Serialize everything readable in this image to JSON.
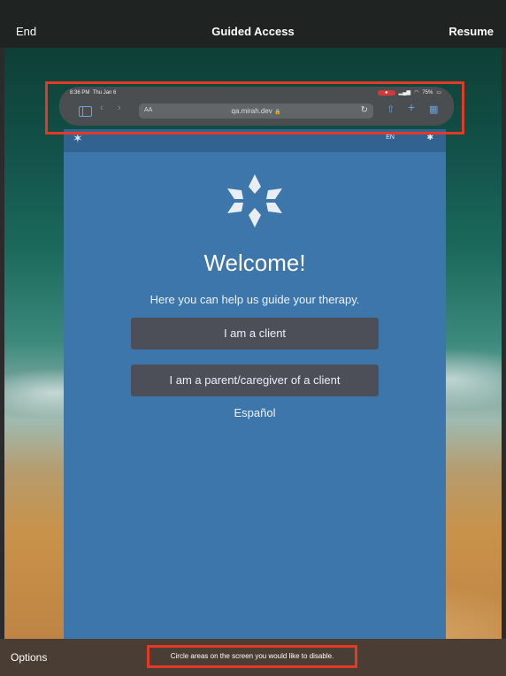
{
  "guided_access": {
    "title": "Guided Access",
    "end_label": "End",
    "resume_label": "Resume",
    "options_label": "Options",
    "hint": "Circle areas on the screen you would like to disable."
  },
  "ipad_status": {
    "time": "8:36 PM",
    "date": "Thu Jan 6",
    "battery": "75%"
  },
  "browser": {
    "text_size_label": "AA",
    "url": "qa.mirah.dev",
    "lock_glyph": "🔒",
    "reload_glyph": "↻",
    "share_glyph": "⇧",
    "add_glyph": "+",
    "tabs_glyph": "▦",
    "back_glyph": "‹",
    "forward_glyph": "›"
  },
  "site": {
    "language_indicator": "EN",
    "welcome": "Welcome!",
    "subtitle": "Here you can help us guide your therapy.",
    "client_button": "I am a client",
    "parent_button": "I am a parent/caregiver of a client",
    "spanish_link": "Español"
  },
  "colors": {
    "accent_red": "#e33a28",
    "site_blue": "#3d76aa",
    "button_gray": "#4c4e58"
  }
}
